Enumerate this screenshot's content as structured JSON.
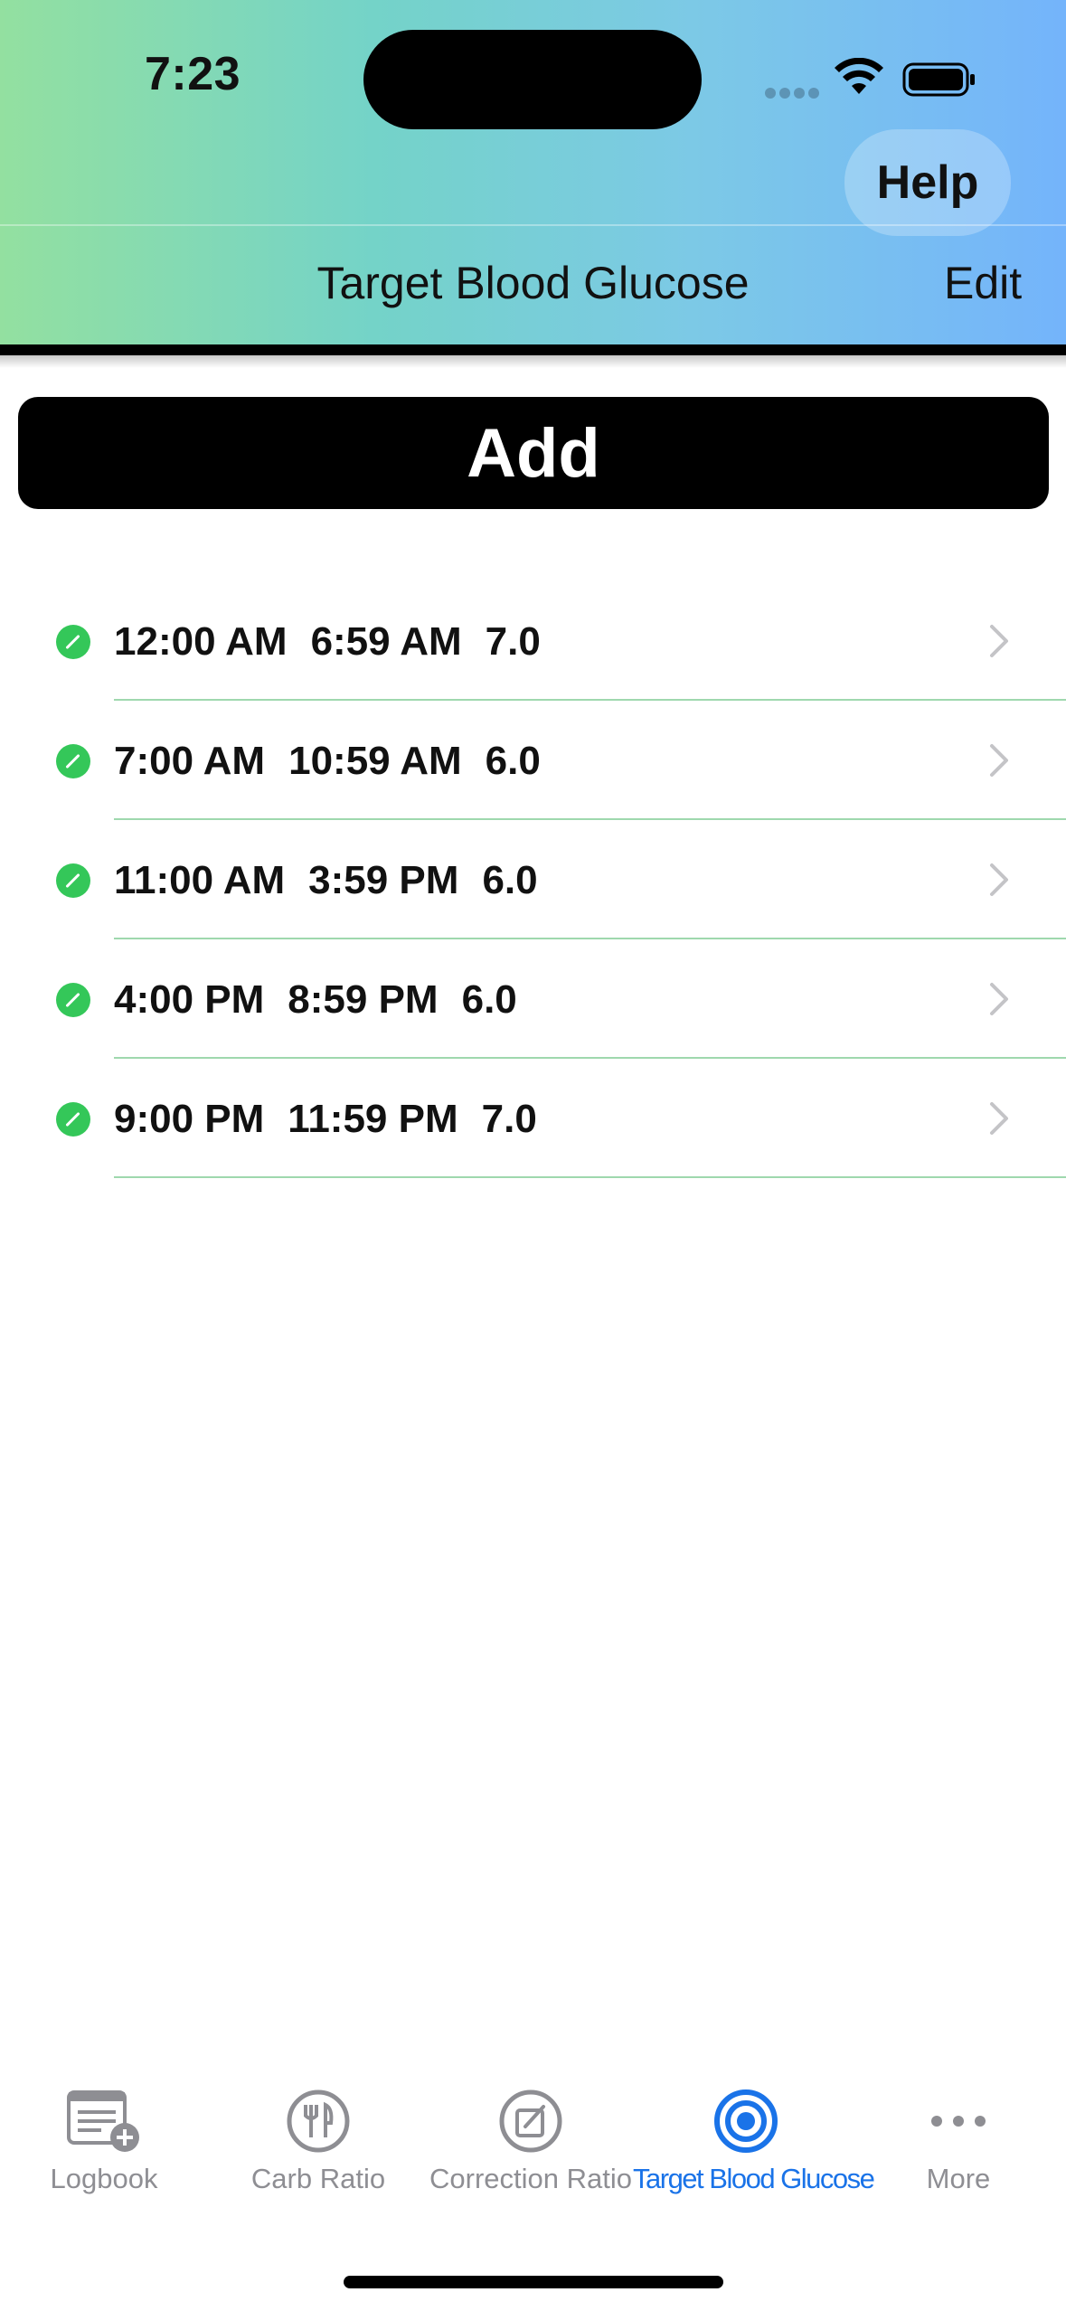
{
  "status_bar": {
    "time": "7:23"
  },
  "header": {
    "help_label": "Help",
    "title": "Target Blood Glucose",
    "edit_label": "Edit"
  },
  "add_label": "Add",
  "entries": [
    {
      "start": "12:00 AM",
      "end": "6:59 AM",
      "target": "7.0"
    },
    {
      "start": "7:00 AM",
      "end": "10:59 AM",
      "target": "6.0"
    },
    {
      "start": "11:00 AM",
      "end": "3:59 PM",
      "target": "6.0"
    },
    {
      "start": "4:00 PM",
      "end": "8:59 PM",
      "target": "6.0"
    },
    {
      "start": "9:00 PM",
      "end": "11:59 PM",
      "target": "7.0"
    }
  ],
  "tabs": [
    {
      "label": "Logbook",
      "icon": "logbook-add-icon",
      "active": false
    },
    {
      "label": "Carb Ratio",
      "icon": "fork-knife-icon",
      "active": false
    },
    {
      "label": "Correction Ratio",
      "icon": "edit-square-icon",
      "active": false
    },
    {
      "label": "Target Blood Glucose",
      "icon": "target-icon",
      "active": true
    },
    {
      "label": "More",
      "icon": "more-dots-icon",
      "active": false
    }
  ],
  "colors": {
    "accent": "#1a73e8",
    "status_green": "#34c759",
    "header_gradient_start": "#93e0a0",
    "header_gradient_end": "#74b4fb"
  }
}
